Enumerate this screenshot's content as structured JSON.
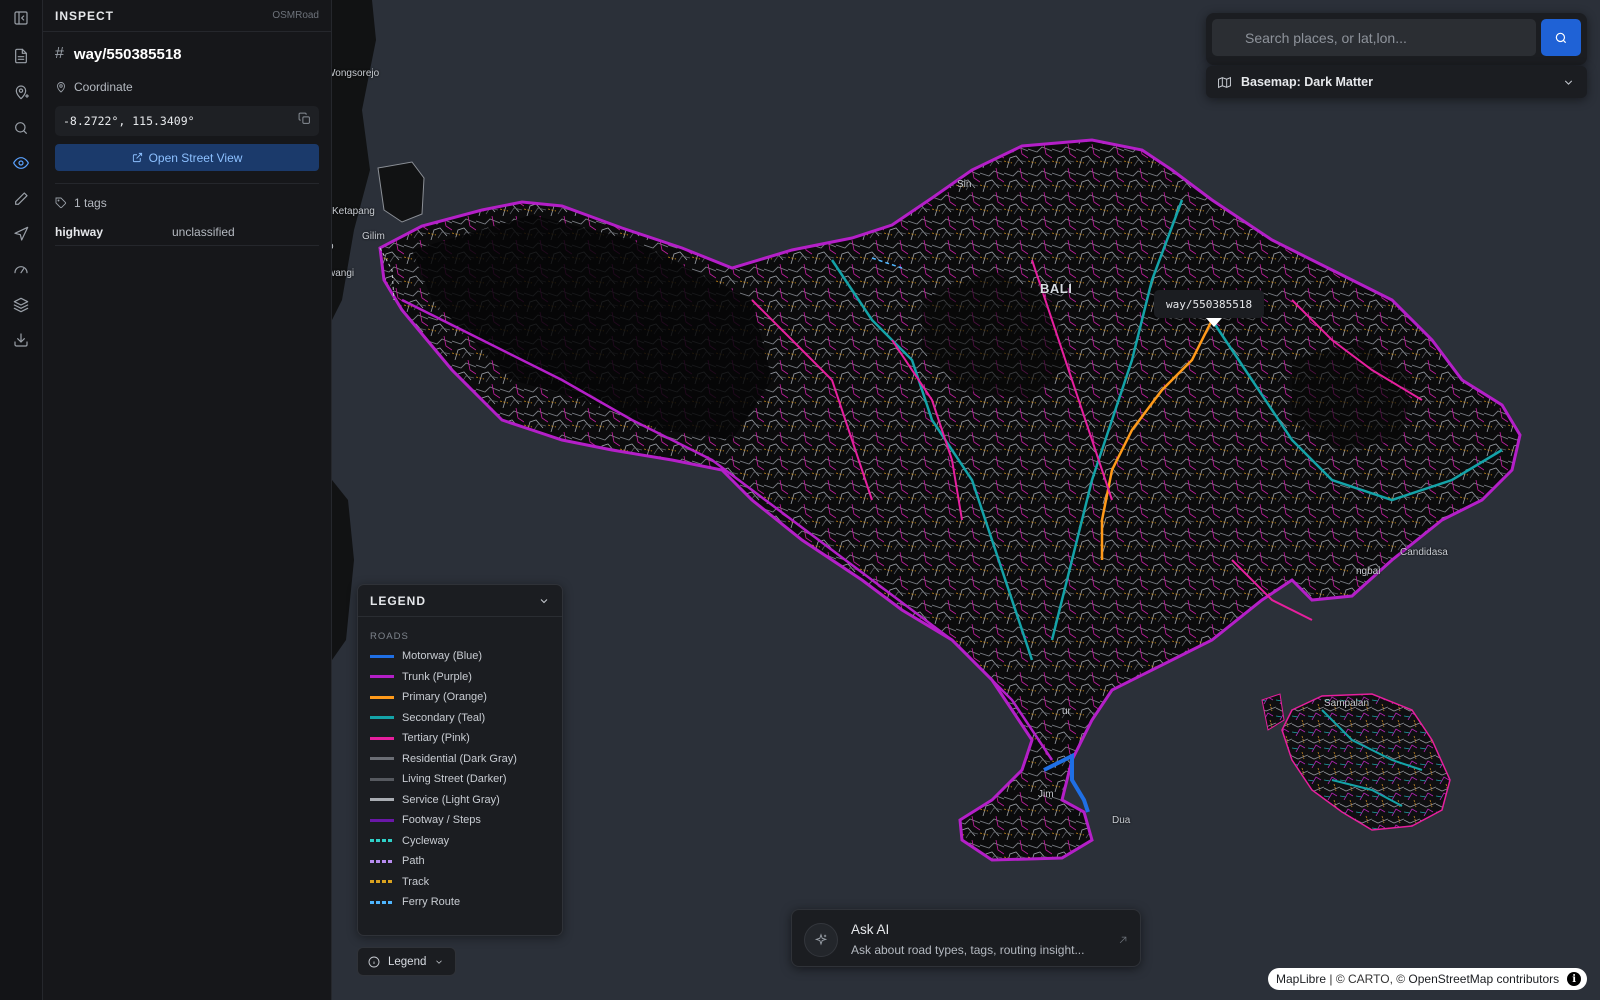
{
  "rail": {
    "items": [
      {
        "name": "panel-toggle-icon"
      },
      {
        "name": "document-icon"
      },
      {
        "name": "map-pin-plus-icon"
      },
      {
        "name": "search-icon"
      },
      {
        "name": "eye-icon",
        "active": true
      },
      {
        "name": "pencil-icon"
      },
      {
        "name": "send-icon"
      },
      {
        "name": "gauge-icon"
      },
      {
        "name": "layers-icon"
      },
      {
        "name": "download-icon"
      }
    ]
  },
  "panel": {
    "title": "INSPECT",
    "brand": "OSMRoad",
    "feature_id": "way/550385518",
    "coordinate_label": "Coordinate",
    "coordinate_value": "-8.2722°, 115.3409°",
    "street_view_label": "Open Street View",
    "tags_label": "1 tags",
    "tags": [
      {
        "key": "highway",
        "value": "unclassified"
      }
    ]
  },
  "map": {
    "tooltip": "way/550385518",
    "places": {
      "bali": "BALI",
      "wongsorejo": "Wongsorejo",
      "ketapang": "Ketapang",
      "gilimanuk": "Gilim",
      "banyuwangi": "wangi",
      "sing": "Sin",
      "candidasa": "Candidasa",
      "padangbai": "ngbai",
      "sanur": "ur",
      "jimbaran": "Jim",
      "nusadua": "Dua",
      "lembongan": "Sampalan",
      "o_label": "o"
    }
  },
  "search": {
    "placeholder": "Search places, or lat,lon...",
    "basemap_label": "Basemap: Dark Matter"
  },
  "legend": {
    "title": "LEGEND",
    "section": "ROADS",
    "items": [
      {
        "label": "Motorway (Blue)",
        "color": "#1f6fe5",
        "style": "solid"
      },
      {
        "label": "Trunk (Purple)",
        "color": "#b41fc8",
        "style": "solid"
      },
      {
        "label": "Primary (Orange)",
        "color": "#ff9a1a",
        "style": "solid"
      },
      {
        "label": "Secondary (Teal)",
        "color": "#14a3a8",
        "style": "solid"
      },
      {
        "label": "Tertiary (Pink)",
        "color": "#e61f9e",
        "style": "solid"
      },
      {
        "label": "Residential (Dark Gray)",
        "color": "#6b6e75",
        "style": "solid"
      },
      {
        "label": "Living Street (Darker)",
        "color": "#56595f",
        "style": "solid"
      },
      {
        "label": "Service (Light Gray)",
        "color": "#a9adb3",
        "style": "solid"
      },
      {
        "label": "Footway / Steps",
        "color": "#6a17a8",
        "style": "solid"
      },
      {
        "label": "Cycleway",
        "color": "#2fd0c8",
        "style": "dashed"
      },
      {
        "label": "Path",
        "color": "#b78cf0",
        "style": "dashed"
      },
      {
        "label": "Track",
        "color": "#d9a21f",
        "style": "dashed"
      },
      {
        "label": "Ferry Route",
        "color": "#4fb6ff",
        "style": "dashed"
      }
    ],
    "toggle_label": "Legend"
  },
  "ask_ai": {
    "title": "Ask AI",
    "subtitle": "Ask about road types, tags, routing insight..."
  },
  "attribution": {
    "maplibre": "MapLibre",
    "carto": "| © CARTO, ©",
    "osm": "OpenStreetMap",
    "contributors": "contributors",
    "info": "i"
  }
}
